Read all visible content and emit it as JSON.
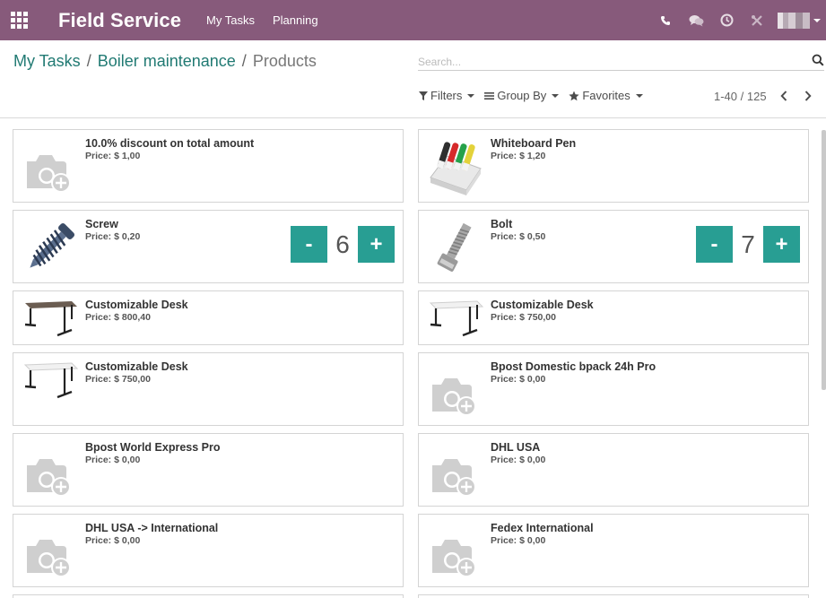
{
  "navbar": {
    "brand": "Field Service",
    "menu": [
      "My Tasks",
      "Planning"
    ],
    "bg_color": "#875a7b"
  },
  "breadcrumb": {
    "items": [
      "My Tasks",
      "Boiler maintenance"
    ],
    "current": "Products"
  },
  "search": {
    "placeholder": "Search..."
  },
  "filters": {
    "filters_label": "Filters",
    "group_by_label": "Group By",
    "favorites_label": "Favorites"
  },
  "pager": {
    "value": "1-40 / 125"
  },
  "accent_color": "#289e93",
  "products": [
    {
      "name": "10.0% discount on total amount",
      "price": "Price: $ 1,00",
      "image": "camera-placeholder-icon"
    },
    {
      "name": "Whiteboard Pen",
      "price": "Price: $ 1,20",
      "image": "whiteboard-pens-image"
    },
    {
      "name": "Screw",
      "price": "Price: $ 0,20",
      "image": "screw-image",
      "quantity": "6"
    },
    {
      "name": "Bolt",
      "price": "Price: $ 0,50",
      "image": "bolt-image",
      "quantity": "7"
    },
    {
      "name": "Customizable Desk",
      "price": "Price: $ 800,40",
      "image": "desk-image"
    },
    {
      "name": "Customizable Desk",
      "price": "Price: $ 750,00",
      "image": "desk-image"
    },
    {
      "name": "Customizable Desk",
      "price": "Price: $ 750,00",
      "image": "desk-image"
    },
    {
      "name": "Bpost Domestic bpack 24h Pro",
      "price": "Price: $ 0,00",
      "image": "camera-placeholder-icon"
    },
    {
      "name": "Bpost World Express Pro",
      "price": "Price: $ 0,00",
      "image": "camera-placeholder-icon"
    },
    {
      "name": "DHL USA",
      "price": "Price: $ 0,00",
      "image": "camera-placeholder-icon"
    },
    {
      "name": "DHL USA -> International",
      "price": "Price: $ 0,00",
      "image": "camera-placeholder-icon"
    },
    {
      "name": "Fedex International",
      "price": "Price: $ 0,00",
      "image": "camera-placeholder-icon"
    }
  ]
}
